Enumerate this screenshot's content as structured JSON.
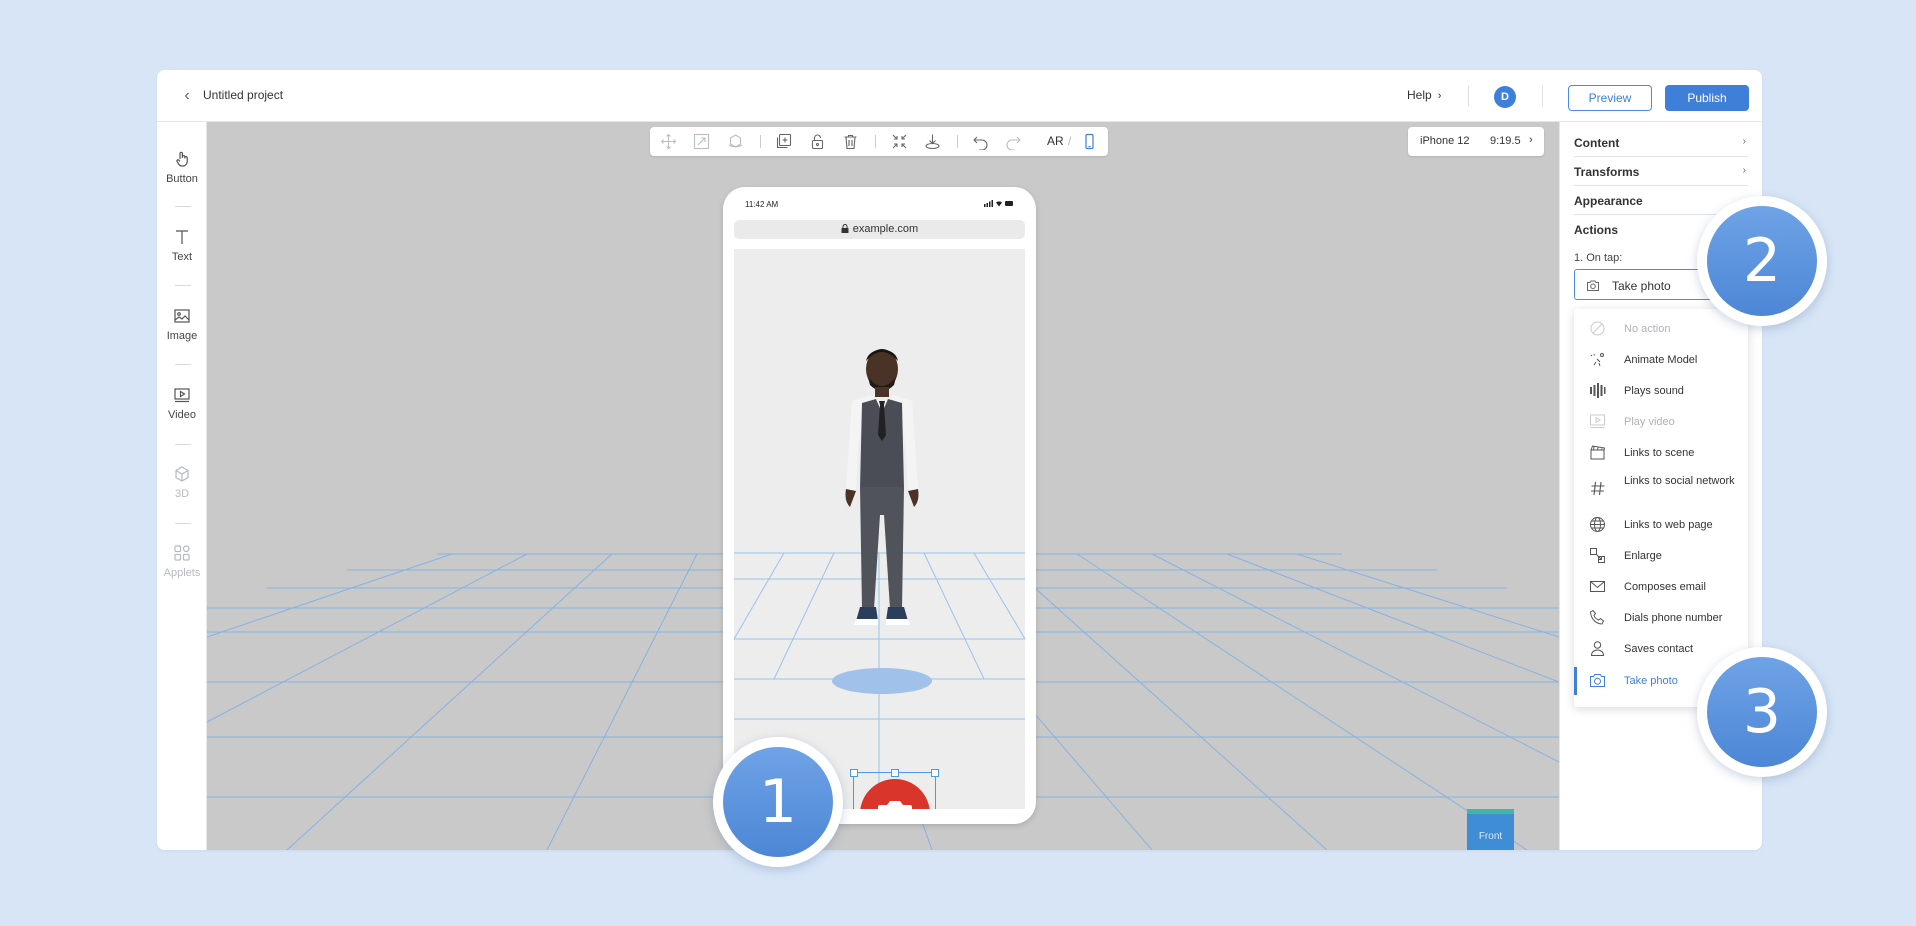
{
  "header": {
    "project_title": "Untitled project",
    "help_label": "Help",
    "avatar_initial": "D",
    "preview_label": "Preview",
    "publish_label": "Publish"
  },
  "sidebar": {
    "items": [
      {
        "label": "Button",
        "icon": "hand-pointer-icon",
        "enabled": true
      },
      {
        "label": "Text",
        "icon": "text-icon",
        "enabled": true
      },
      {
        "label": "Image",
        "icon": "image-icon",
        "enabled": true
      },
      {
        "label": "Video",
        "icon": "video-icon",
        "enabled": true
      },
      {
        "label": "3D",
        "icon": "cube-icon",
        "enabled": false
      },
      {
        "label": "Applets",
        "icon": "applets-icon",
        "enabled": false
      }
    ]
  },
  "toolbar": {
    "ar_label": "AR",
    "slash": "/",
    "icons": [
      "move-icon",
      "scale-icon",
      "rotate-icon",
      "duplicate-icon",
      "unlock-icon",
      "trash-icon",
      "collapse-icon",
      "anchor-icon",
      "undo-icon",
      "redo-icon",
      "phone-icon"
    ]
  },
  "device": {
    "name": "iPhone 12",
    "ratio": "9:19.5"
  },
  "phone": {
    "time": "11:42 AM",
    "url": "example.com"
  },
  "view_cube": {
    "label": "Front"
  },
  "panel": {
    "sections": [
      {
        "label": "Content"
      },
      {
        "label": "Transforms"
      },
      {
        "label": "Appearance"
      },
      {
        "label": "Actions"
      }
    ],
    "on_tap_label": "1. On tap:",
    "selected_action": "Take photo",
    "options": [
      {
        "label": "No action",
        "icon": "no-action-icon",
        "state": "disabled"
      },
      {
        "label": "Animate Model",
        "icon": "animate-icon",
        "state": "normal"
      },
      {
        "label": "Plays sound",
        "icon": "sound-icon",
        "state": "normal"
      },
      {
        "label": "Play video",
        "icon": "video-icon",
        "state": "disabled"
      },
      {
        "label": "Links to scene",
        "icon": "clapperboard-icon",
        "state": "normal"
      },
      {
        "label": "Links to social network",
        "icon": "hashtag-icon",
        "state": "normal"
      },
      {
        "label": "Links to web page",
        "icon": "globe-icon",
        "state": "normal"
      },
      {
        "label": "Enlarge",
        "icon": "enlarge-icon",
        "state": "normal"
      },
      {
        "label": "Composes email",
        "icon": "envelope-icon",
        "state": "normal"
      },
      {
        "label": "Dials phone number",
        "icon": "phone-icon",
        "state": "normal"
      },
      {
        "label": "Saves contact",
        "icon": "person-icon",
        "state": "normal"
      },
      {
        "label": "Take photo",
        "icon": "camera-icon",
        "state": "selected"
      }
    ]
  },
  "callouts": [
    "1",
    "2",
    "3"
  ],
  "colors": {
    "accent": "#3d7fd9",
    "background": "#d7e5f7",
    "viewport": "#c9c9c9",
    "camera_button": "#d9352b"
  }
}
